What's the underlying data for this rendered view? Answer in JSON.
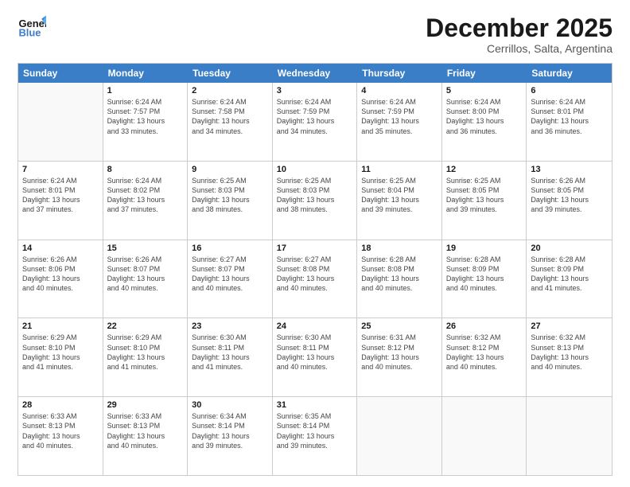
{
  "logo": {
    "line1": "General",
    "line2": "Blue"
  },
  "title": "December 2025",
  "location": "Cerrillos, Salta, Argentina",
  "header_days": [
    "Sunday",
    "Monday",
    "Tuesday",
    "Wednesday",
    "Thursday",
    "Friday",
    "Saturday"
  ],
  "rows": [
    [
      {
        "day": "",
        "info": ""
      },
      {
        "day": "1",
        "info": "Sunrise: 6:24 AM\nSunset: 7:57 PM\nDaylight: 13 hours\nand 33 minutes."
      },
      {
        "day": "2",
        "info": "Sunrise: 6:24 AM\nSunset: 7:58 PM\nDaylight: 13 hours\nand 34 minutes."
      },
      {
        "day": "3",
        "info": "Sunrise: 6:24 AM\nSunset: 7:59 PM\nDaylight: 13 hours\nand 34 minutes."
      },
      {
        "day": "4",
        "info": "Sunrise: 6:24 AM\nSunset: 7:59 PM\nDaylight: 13 hours\nand 35 minutes."
      },
      {
        "day": "5",
        "info": "Sunrise: 6:24 AM\nSunset: 8:00 PM\nDaylight: 13 hours\nand 36 minutes."
      },
      {
        "day": "6",
        "info": "Sunrise: 6:24 AM\nSunset: 8:01 PM\nDaylight: 13 hours\nand 36 minutes."
      }
    ],
    [
      {
        "day": "7",
        "info": "Sunrise: 6:24 AM\nSunset: 8:01 PM\nDaylight: 13 hours\nand 37 minutes."
      },
      {
        "day": "8",
        "info": "Sunrise: 6:24 AM\nSunset: 8:02 PM\nDaylight: 13 hours\nand 37 minutes."
      },
      {
        "day": "9",
        "info": "Sunrise: 6:25 AM\nSunset: 8:03 PM\nDaylight: 13 hours\nand 38 minutes."
      },
      {
        "day": "10",
        "info": "Sunrise: 6:25 AM\nSunset: 8:03 PM\nDaylight: 13 hours\nand 38 minutes."
      },
      {
        "day": "11",
        "info": "Sunrise: 6:25 AM\nSunset: 8:04 PM\nDaylight: 13 hours\nand 39 minutes."
      },
      {
        "day": "12",
        "info": "Sunrise: 6:25 AM\nSunset: 8:05 PM\nDaylight: 13 hours\nand 39 minutes."
      },
      {
        "day": "13",
        "info": "Sunrise: 6:26 AM\nSunset: 8:05 PM\nDaylight: 13 hours\nand 39 minutes."
      }
    ],
    [
      {
        "day": "14",
        "info": "Sunrise: 6:26 AM\nSunset: 8:06 PM\nDaylight: 13 hours\nand 40 minutes."
      },
      {
        "day": "15",
        "info": "Sunrise: 6:26 AM\nSunset: 8:07 PM\nDaylight: 13 hours\nand 40 minutes."
      },
      {
        "day": "16",
        "info": "Sunrise: 6:27 AM\nSunset: 8:07 PM\nDaylight: 13 hours\nand 40 minutes."
      },
      {
        "day": "17",
        "info": "Sunrise: 6:27 AM\nSunset: 8:08 PM\nDaylight: 13 hours\nand 40 minutes."
      },
      {
        "day": "18",
        "info": "Sunrise: 6:28 AM\nSunset: 8:08 PM\nDaylight: 13 hours\nand 40 minutes."
      },
      {
        "day": "19",
        "info": "Sunrise: 6:28 AM\nSunset: 8:09 PM\nDaylight: 13 hours\nand 40 minutes."
      },
      {
        "day": "20",
        "info": "Sunrise: 6:28 AM\nSunset: 8:09 PM\nDaylight: 13 hours\nand 41 minutes."
      }
    ],
    [
      {
        "day": "21",
        "info": "Sunrise: 6:29 AM\nSunset: 8:10 PM\nDaylight: 13 hours\nand 41 minutes."
      },
      {
        "day": "22",
        "info": "Sunrise: 6:29 AM\nSunset: 8:10 PM\nDaylight: 13 hours\nand 41 minutes."
      },
      {
        "day": "23",
        "info": "Sunrise: 6:30 AM\nSunset: 8:11 PM\nDaylight: 13 hours\nand 41 minutes."
      },
      {
        "day": "24",
        "info": "Sunrise: 6:30 AM\nSunset: 8:11 PM\nDaylight: 13 hours\nand 40 minutes."
      },
      {
        "day": "25",
        "info": "Sunrise: 6:31 AM\nSunset: 8:12 PM\nDaylight: 13 hours\nand 40 minutes."
      },
      {
        "day": "26",
        "info": "Sunrise: 6:32 AM\nSunset: 8:12 PM\nDaylight: 13 hours\nand 40 minutes."
      },
      {
        "day": "27",
        "info": "Sunrise: 6:32 AM\nSunset: 8:13 PM\nDaylight: 13 hours\nand 40 minutes."
      }
    ],
    [
      {
        "day": "28",
        "info": "Sunrise: 6:33 AM\nSunset: 8:13 PM\nDaylight: 13 hours\nand 40 minutes."
      },
      {
        "day": "29",
        "info": "Sunrise: 6:33 AM\nSunset: 8:13 PM\nDaylight: 13 hours\nand 40 minutes."
      },
      {
        "day": "30",
        "info": "Sunrise: 6:34 AM\nSunset: 8:14 PM\nDaylight: 13 hours\nand 39 minutes."
      },
      {
        "day": "31",
        "info": "Sunrise: 6:35 AM\nSunset: 8:14 PM\nDaylight: 13 hours\nand 39 minutes."
      },
      {
        "day": "",
        "info": ""
      },
      {
        "day": "",
        "info": ""
      },
      {
        "day": "",
        "info": ""
      }
    ]
  ]
}
